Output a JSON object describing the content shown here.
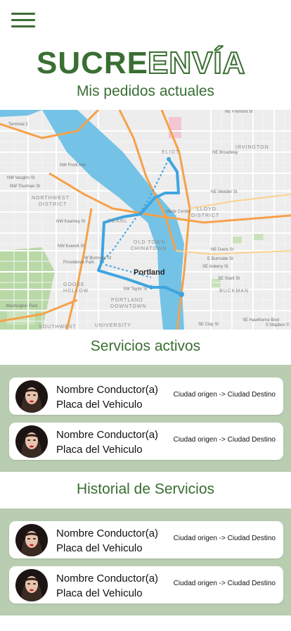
{
  "header": {
    "menu_icon": "hamburger-menu-icon",
    "logo_part1": "SUCRE",
    "logo_part2": "ENVÍA",
    "brand_color": "#3a6e33"
  },
  "sections": {
    "current_orders": "Mis pedidos actuales",
    "active_services": "Servicios activos",
    "history": "Historial de Servicios"
  },
  "map": {
    "labels": {
      "portland": "Portland",
      "pearl": "PEARL",
      "old_town": "OLD TOWN",
      "chinatown": "CHINATOWN",
      "portland_downtown_1": "PORTLAND",
      "portland_downtown_2": "DOWNTOWN",
      "northwest_1": "NORTHWEST",
      "northwest_2": "DISTRICT",
      "lloyd_1": "LLOYD",
      "lloyd_2": "DISTRICT",
      "irvington": "IRVINGTON",
      "buckman": "BUCKMAN",
      "eliot": "ELIOT",
      "goose_1": "GOOSE",
      "goose_2": "HOLLOW",
      "washington_park": "Washington Park",
      "providence_park": "Providence Park",
      "moda": "Moda Center",
      "southwest": "SOUTHWEST",
      "university": "UNIVERSITY",
      "terminal2": "Terminal 2",
      "attribution": "© Mapbox ©",
      "ne_fremont": "NE Fremont St",
      "ne_broadway": "NE Broadway",
      "ne_weidler": "NE Weidler St",
      "ne_davis": "NE Davis St",
      "e_burnside": "E Burnside St",
      "se_ankeny": "SE Ankeny St",
      "se_stark": "SE Stark St",
      "se_hawthorne": "SE Hawthorne Blvd",
      "se_clay": "SE Clay St",
      "sw_taylor": "SW Taylor St",
      "w_burnside": "W Burnside St",
      "nw_everett": "NW Everett St",
      "nw_kearney": "NW Kearney St",
      "nw_thurman": "NW Thurman St",
      "nw_vaughn": "NW Vaughn St",
      "nw_front": "NW Front Ave"
    }
  },
  "active_services": [
    {
      "driver": "Nombre Conductor(a)",
      "plate": "Placa del Vehiculo",
      "route": "Ciudad origen -> Ciudad Destino"
    },
    {
      "driver": "Nombre Conductor(a)",
      "plate": "Placa del Vehiculo",
      "route": "Ciudad origen -> Ciudad Destino"
    }
  ],
  "history_services": [
    {
      "driver": "Nombre Conductor(a)",
      "plate": "Placa del Vehiculo",
      "route": "Ciudad origen -> Ciudad Destino"
    },
    {
      "driver": "Nombre Conductor(a)",
      "plate": "Placa del Vehiculo",
      "route": "Ciudad origen -> Ciudad Destino"
    }
  ]
}
